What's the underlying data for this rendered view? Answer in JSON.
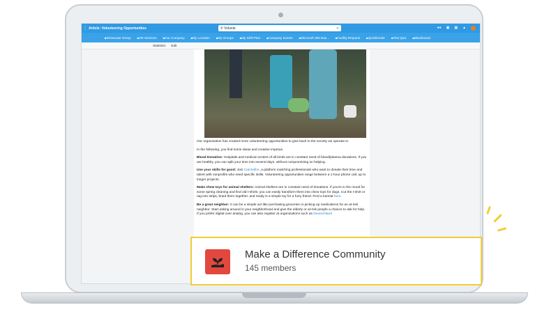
{
  "browser": {
    "tab_title": "Article: Volunteering Opportunities",
    "search_value": "Volunte"
  },
  "nav": {
    "items": [
      "Showcase Group",
      "HR Services",
      "Our Company",
      "My Location",
      "My Groups",
      "My Shift Plan",
      "Company Events",
      "Microsoft 365 Das...",
      "Facility Request",
      "Quicklender",
      "Test Quiz",
      "Blackboard"
    ]
  },
  "subbar": {
    "statistics": "Statistics",
    "edit": "Edit"
  },
  "article": {
    "intro": "Our organization has created more volunteering opportunities to give back to the society we operate in.",
    "lead": "In the following, you find some ideas and creative impetus.",
    "p1_bold": "Blood Donation:",
    "p1_text": " Hospitals and medical centers of all kinds are in constant need of blood/plasma donations. If you are healthy, you can split your time into several days, without compromising on helping.",
    "p2_bold": "Use your skills for good:",
    "p2_pre": " Join ",
    "p2_link": "Catchafire",
    "p2_text": ", a platform matching professionals who want to donate their time and talent with nonprofits who need specific skills. Volunteering opportunities range between a 1-hour phone call, up to longer projects.",
    "p3_bold": "Make chew toys for animal shelters:",
    "p3_text": " Animal shelters are in constant need of donations. If you're in the mood for some spring cleaning and find old t-shirts, you can easily transform them into chew toys for dogs. Cut the t-shirt or rag into strips, braid them together, and ready is a simple toy for a furry friend. Find a tutorial ",
    "p3_link": "here",
    "p4_bold": "Be a great neighbor:",
    "p4_text": " It can be a simple act like purchasing groceries or picking up medications for an at-risk neighbor. Start asking around in your neighborhood and give the elderly or at-risk people a chance to ask for help. If you prefer digital over analog, you can also register at organizations such as ",
    "p4_link": "Deutschland"
  },
  "community_card": {
    "name": "Make a Difference Community",
    "members": "145 members",
    "icon": "plant-hand-icon",
    "icon_color": "#e2483d",
    "border_color": "#f2cd33"
  },
  "colors": {
    "topbar": "#2f99e3",
    "navbar": "#3aa2e8"
  }
}
